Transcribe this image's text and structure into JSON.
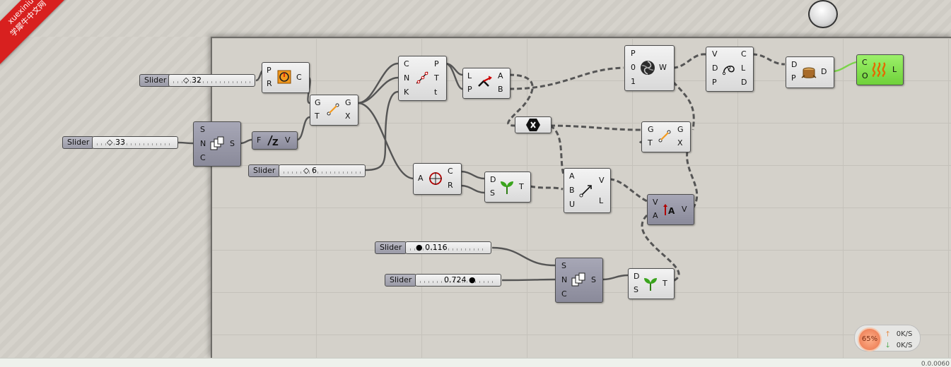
{
  "watermark": {
    "line1": "xuexiniu",
    "line2": "学犀牛中文网"
  },
  "sliders": [
    {
      "label": "Slider",
      "value": "32"
    },
    {
      "label": "Slider",
      "value": "33"
    },
    {
      "label": "Slider",
      "value": "6"
    },
    {
      "label": "Slider",
      "value": "0.116"
    },
    {
      "label": "Slider",
      "value": "0.724"
    }
  ],
  "components": {
    "circle": {
      "inputs": [
        "P",
        "R"
      ],
      "outputs": [
        "C"
      ]
    },
    "series": {
      "inputs": [
        "S",
        "N",
        "C"
      ],
      "outputs": [
        "S"
      ]
    },
    "unit_z": {
      "inputs": [
        "F"
      ],
      "outputs": [
        "V"
      ]
    },
    "move1": {
      "inputs": [
        "G",
        "T"
      ],
      "outputs": [
        "G",
        "X"
      ]
    },
    "divide_curve": {
      "inputs": [
        "C",
        "N",
        "K"
      ],
      "outputs": [
        "P",
        "T",
        "t"
      ]
    },
    "shift_list": {
      "inputs": [
        "L",
        "P"
      ],
      "outputs": [
        "A",
        "B"
      ]
    },
    "weave": {
      "inputs": [
        "P",
        "0",
        "1"
      ],
      "outputs": [
        "W"
      ]
    },
    "interp_curve": {
      "inputs": [
        "V",
        "D",
        "P"
      ],
      "outputs": [
        "C",
        "L",
        "D"
      ]
    },
    "pipe": {
      "inputs": [
        "D",
        "P"
      ],
      "outputs": [
        "D"
      ]
    },
    "preview": {
      "inputs": [
        "C",
        "O"
      ],
      "outputs": [
        "L"
      ]
    },
    "cull": {},
    "move2": {
      "inputs": [
        "G",
        "T"
      ],
      "outputs": [
        "G",
        "X"
      ]
    },
    "circle_cnr": {
      "inputs": [
        "A"
      ],
      "outputs": [
        "C",
        "R"
      ]
    },
    "graft1": {
      "inputs": [
        "D",
        "S"
      ],
      "outputs": [
        "T"
      ]
    },
    "vector2pt": {
      "inputs": [
        "A",
        "B",
        "U"
      ],
      "outputs": [
        "V",
        "L"
      ]
    },
    "amplitude": {
      "inputs": [
        "V",
        "A"
      ],
      "outputs": [
        "V"
      ]
    },
    "series2": {
      "inputs": [
        "S",
        "N",
        "C"
      ],
      "outputs": [
        "S"
      ]
    },
    "graft2": {
      "inputs": [
        "D",
        "S"
      ],
      "outputs": [
        "T"
      ]
    }
  },
  "network_monitor": {
    "percent": "65%",
    "upload": "0K/S",
    "download": "0K/S"
  },
  "corner_text": "0.0.0060"
}
